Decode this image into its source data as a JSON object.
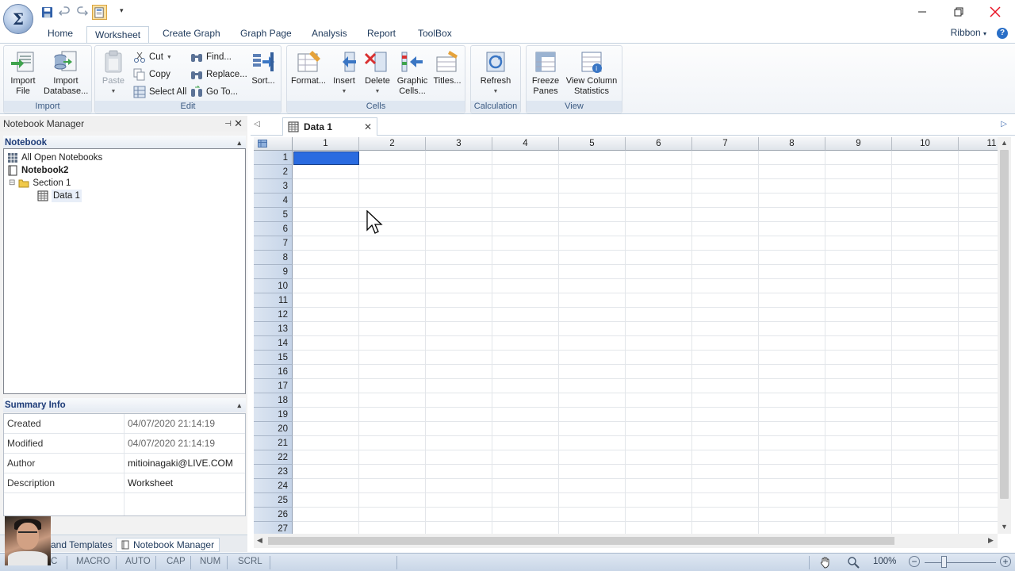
{
  "app": {
    "logo_glyph": "Σ"
  },
  "quick_access": {
    "icons": [
      "save-icon",
      "undo-icon",
      "redo-icon",
      "notebook-open-icon"
    ],
    "dropdown_glyph": "▾"
  },
  "window_controls": {
    "minimize": "—",
    "restore": "❐",
    "close": "✕"
  },
  "ribbon_tabs": [
    "Home",
    "Worksheet",
    "Create Graph",
    "Graph Page",
    "Analysis",
    "Report",
    "ToolBox"
  ],
  "ribbon_active_tab": "Worksheet",
  "ribbon_menu": {
    "label": "Ribbon",
    "help": "?"
  },
  "ribbon": {
    "import": {
      "label": "Import",
      "import_file": "Import\nFile",
      "import_database": "Import\nDatabase..."
    },
    "edit": {
      "label": "Edit",
      "paste": "Paste",
      "cut": "Cut",
      "copy": "Copy",
      "select_all": "Select All",
      "find": "Find...",
      "replace": "Replace...",
      "goto": "Go To...",
      "sort": "Sort..."
    },
    "cells": {
      "label": "Cells",
      "format": "Format...",
      "insert": "Insert",
      "delete": "Delete",
      "graphic_cells": "Graphic\nCells...",
      "titles": "Titles..."
    },
    "calculation": {
      "label": "Calculation",
      "refresh": "Refresh"
    },
    "view": {
      "label": "View",
      "freeze_panes": "Freeze\nPanes",
      "view_column_statistics": "View Column\nStatistics"
    }
  },
  "notebook_manager": {
    "title": "Notebook Manager",
    "pin": "⊣",
    "close": "✕",
    "notebook_section": "Notebook",
    "collapse_glyph": "▴",
    "tree": {
      "all_open": "All Open Notebooks",
      "notebook": "Notebook2",
      "expander": "⊟",
      "section": "Section 1",
      "data": "Data 1"
    },
    "summary_section": "Summary Info",
    "summary": [
      {
        "key": "Created",
        "value": "04/07/2020 21:14:19"
      },
      {
        "key": "Modified",
        "value": "04/07/2020 21:14:19"
      },
      {
        "key": "Author",
        "value": "mitioinagaki@LIVE.COM"
      },
      {
        "key": "Description",
        "value": "Worksheet"
      },
      {
        "key": "",
        "value": ""
      }
    ],
    "bottom_tabs": {
      "templates": "and Templates",
      "manager": "Notebook Manager"
    }
  },
  "document": {
    "tab_label": "Data 1",
    "tab_close": "✕",
    "prev_glyph": "◁",
    "next_glyph": "▷"
  },
  "worksheet": {
    "columns": [
      "1",
      "2",
      "3",
      "4",
      "5",
      "6",
      "7",
      "8",
      "9",
      "10",
      "11"
    ],
    "rows": [
      "1",
      "2",
      "3",
      "4",
      "5",
      "6",
      "7",
      "8",
      "9",
      "10",
      "11",
      "12",
      "13",
      "14",
      "15",
      "16",
      "17",
      "18",
      "19",
      "20",
      "21",
      "22",
      "23",
      "24",
      "25",
      "26",
      "27"
    ],
    "selected_cell": {
      "row": "1",
      "column": "1"
    }
  },
  "status_bar": {
    "items": [
      "C",
      "MACRO",
      "AUTO",
      "CAP",
      "NUM",
      "SCRL"
    ],
    "zoom": "100%",
    "zoom_minus": "−",
    "zoom_plus": "+",
    "hand_icon": "hand-pan-icon",
    "zoom_icon": "magnifier-icon"
  },
  "colors": {
    "ribbon_text": "#1e395b",
    "selection": "#2a6be0",
    "row_header": "#c5d4e8",
    "close_red": "#e81123"
  }
}
